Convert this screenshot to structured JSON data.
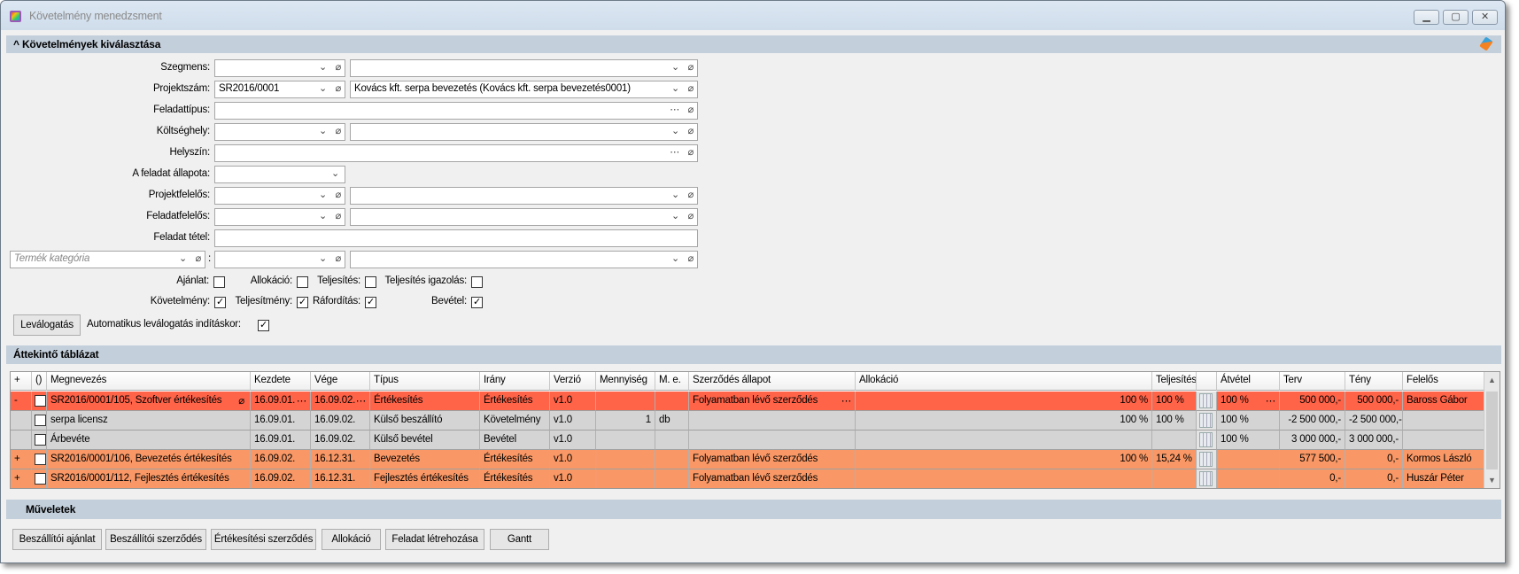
{
  "window": {
    "title": "Követelmény menedzsment",
    "min": "▁",
    "max": "▢",
    "close": "✕"
  },
  "filter": {
    "section_title": "Követelmények kiválasztása",
    "collapse_icon": "^",
    "rows": [
      {
        "label": "Szegmens:",
        "value1": "",
        "value2": ""
      },
      {
        "label": "Projektszám:",
        "value1": "SR2016/0001",
        "value2": "Kovács kft. serpa bevezetés (Kovács kft. serpa bevezetés0001)"
      },
      {
        "label": "Feladattípus:",
        "value1": ""
      },
      {
        "label": "Költséghely:",
        "value1": "",
        "value2": ""
      },
      {
        "label": "Helyszín:",
        "value1": ""
      },
      {
        "label": "A feladat állapota:",
        "value1": ""
      },
      {
        "label": "Projektfelelős:",
        "value1": "",
        "value2": ""
      },
      {
        "label": "Feladatfelelős:",
        "value1": "",
        "value2": ""
      },
      {
        "label": "Feladat tétel:",
        "value1": ""
      }
    ],
    "product_category_placeholder": "Termék kategória",
    "colon": ":",
    "checks1": [
      {
        "label": "Ajánlat:",
        "checked": false
      },
      {
        "label": "Allokáció:",
        "checked": false
      },
      {
        "label": "Teljesítés:",
        "checked": false
      },
      {
        "label": "Teljesítés igazolás:",
        "checked": false
      }
    ],
    "checks2": [
      {
        "label": "Követelmény:",
        "checked": true
      },
      {
        "label": "Teljesítmény:",
        "checked": true
      },
      {
        "label": "Ráfordítás:",
        "checked": true
      },
      {
        "label": "Bevétel:",
        "checked": true
      }
    ],
    "filter_button": "Leválogatás",
    "auto_filter_label": "Automatikus leválogatás indításkor:",
    "auto_filter_checked": true
  },
  "table": {
    "section_title": "Áttekintő táblázat",
    "columns": [
      "+",
      "()",
      "Megnevezés",
      "Kezdete",
      "Vége",
      "Típus",
      "Irány",
      "Verzió",
      "Mennyiség",
      "M. e.",
      "Szerződés állapot",
      "Allokáció",
      "Teljesítés",
      "",
      "Átvétel",
      "Terv",
      "Tény",
      "Felelős"
    ],
    "rows": [
      {
        "color": "#ff6348",
        "cells": [
          "-",
          "",
          "SR2016/0001/105, Szoftver értékesítés",
          "16.09.01.",
          "16.09.02.",
          "Értékesítés",
          "Értékesítés",
          "v1.0",
          "",
          "",
          "Folyamatban lévő szerződés",
          "100 %",
          "100 %",
          "",
          "100 %",
          "500 000,-",
          "500 000,-",
          "Baross Gábor"
        ],
        "clip": true,
        "ellipsis": true
      },
      {
        "color": "#d4d4d4",
        "cells": [
          "",
          "",
          "serpa licensz",
          "16.09.01.",
          "16.09.02.",
          "Külső beszállító",
          "Követelmény",
          "v1.0",
          "1",
          "db",
          "",
          "100 %",
          "100 %",
          "",
          "100 %",
          "-2 500 000,-",
          "-2 500 000,-",
          ""
        ]
      },
      {
        "color": "#d4d4d4",
        "cells": [
          "",
          "",
          "Árbevéte",
          "16.09.01.",
          "16.09.02.",
          "Külső bevétel",
          "Bevétel",
          "v1.0",
          "",
          "",
          "",
          "",
          "",
          "",
          "100 %",
          "3 000 000,-",
          "3 000 000,-",
          ""
        ]
      },
      {
        "color": "#f99866",
        "cells": [
          "+",
          "",
          "SR2016/0001/106, Bevezetés értékesítés",
          "16.09.02.",
          "16.12.31.",
          "Bevezetés",
          "Értékesítés",
          "v1.0",
          "",
          "",
          "Folyamatban lévő szerződés",
          "100 %",
          "15,24 %",
          "",
          "",
          "577 500,-",
          "0,-",
          "Kormos László"
        ]
      },
      {
        "color": "#f99866",
        "cells": [
          "+",
          "",
          "SR2016/0001/112, Fejlesztés értékesítés",
          "16.09.02.",
          "16.12.31.",
          "Fejlesztés értékesítés",
          "Értékesítés",
          "v1.0",
          "",
          "",
          "Folyamatban lévő szerződés",
          "",
          "",
          "",
          "",
          "0,-",
          "0,-",
          "Huszár Péter"
        ]
      }
    ]
  },
  "actions": {
    "section_title": "Műveletek",
    "buttons": [
      "Beszállítói ajánlat",
      "Beszállítói szerződés",
      "Értékesítési szerződés",
      "Allokáció",
      "Feladat létrehozása",
      "Gantt"
    ]
  }
}
